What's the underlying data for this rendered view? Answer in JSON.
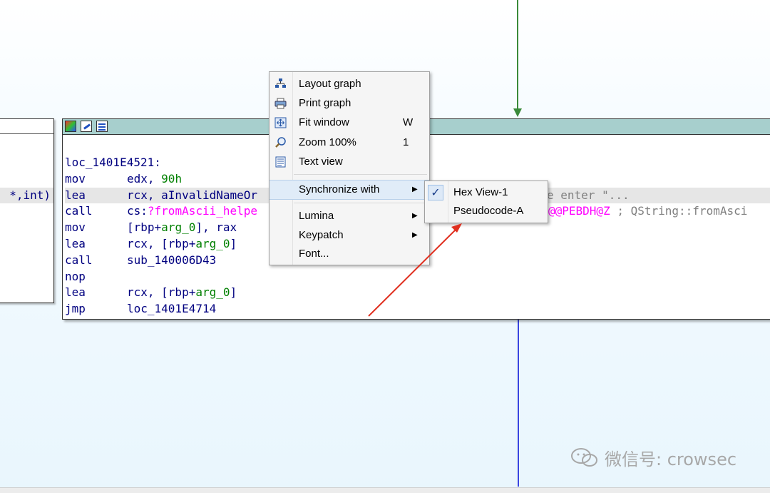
{
  "graph": {
    "left_node_fragment": "*,int)",
    "block": {
      "label": "loc_1401E4521:",
      "rows": [
        {
          "mnemonic": "mov",
          "operand": [
            {
              "t": "edx, "
            },
            {
              "t": "90h",
              "c": "grn"
            }
          ]
        },
        {
          "mnemonic": "lea",
          "operand": [
            {
              "t": "rcx, aInvalidNameOr"
            }
          ],
          "highlight": true,
          "trail": "e enter \"...",
          "trail_color": "cmt"
        },
        {
          "mnemonic": "call",
          "operand": [
            {
              "t": "cs:"
            },
            {
              "t": "?fromAscii_helpe",
              "c": "pink"
            }
          ],
          "trail_parts": [
            {
              "t": "@@PEBDH@Z",
              "c": "pink"
            },
            {
              "t": " ; QString::fromAsci",
              "c": "cmt"
            }
          ]
        },
        {
          "mnemonic": "mov",
          "operand": [
            {
              "t": "[rbp+"
            },
            {
              "t": "arg_0",
              "c": "grn"
            },
            {
              "t": "], rax"
            }
          ]
        },
        {
          "mnemonic": "lea",
          "operand": [
            {
              "t": "rcx, [rbp+"
            },
            {
              "t": "arg_0",
              "c": "grn"
            },
            {
              "t": "]"
            }
          ]
        },
        {
          "mnemonic": "call",
          "operand": [
            {
              "t": "sub_140006D43"
            }
          ]
        },
        {
          "mnemonic": "nop",
          "operand": []
        },
        {
          "mnemonic": "lea",
          "operand": [
            {
              "t": "rcx, [rbp+"
            },
            {
              "t": "arg_0",
              "c": "grn"
            },
            {
              "t": "]"
            }
          ]
        },
        {
          "mnemonic": "jmp",
          "operand": [
            {
              "t": "loc_1401E4714"
            }
          ]
        }
      ]
    }
  },
  "context_menu": {
    "items": [
      {
        "label": "Layout graph",
        "shortcut": "",
        "icon": "layout-graph-icon"
      },
      {
        "label": "Print graph",
        "shortcut": "",
        "icon": "printer-icon"
      },
      {
        "label": "Fit window",
        "shortcut": "W",
        "icon": "fit-window-icon"
      },
      {
        "label": "Zoom 100%",
        "shortcut": "1",
        "icon": "zoom-icon"
      },
      {
        "label": "Text view",
        "shortcut": "",
        "icon": "text-view-icon"
      },
      {
        "label": "Synchronize with",
        "submenu": true
      },
      {
        "label": "Lumina",
        "submenu": true
      },
      {
        "label": "Keypatch",
        "submenu": true
      },
      {
        "label": "Font...",
        "submenu": false
      }
    ]
  },
  "submenu": {
    "items": [
      {
        "label": "Hex View-1",
        "checked": true
      },
      {
        "label": "Pseudocode-A",
        "checked": false
      }
    ]
  },
  "watermark": "微信号: crowsec",
  "colors": {
    "node_header": "#a7cfcd",
    "edge_green": "#3a8a3a",
    "edge_blue": "#3a45e0",
    "annotation_arrow": "#e03020",
    "code_text": "#000080",
    "pink_name": "#ff00ff",
    "green_arg": "#008000"
  }
}
